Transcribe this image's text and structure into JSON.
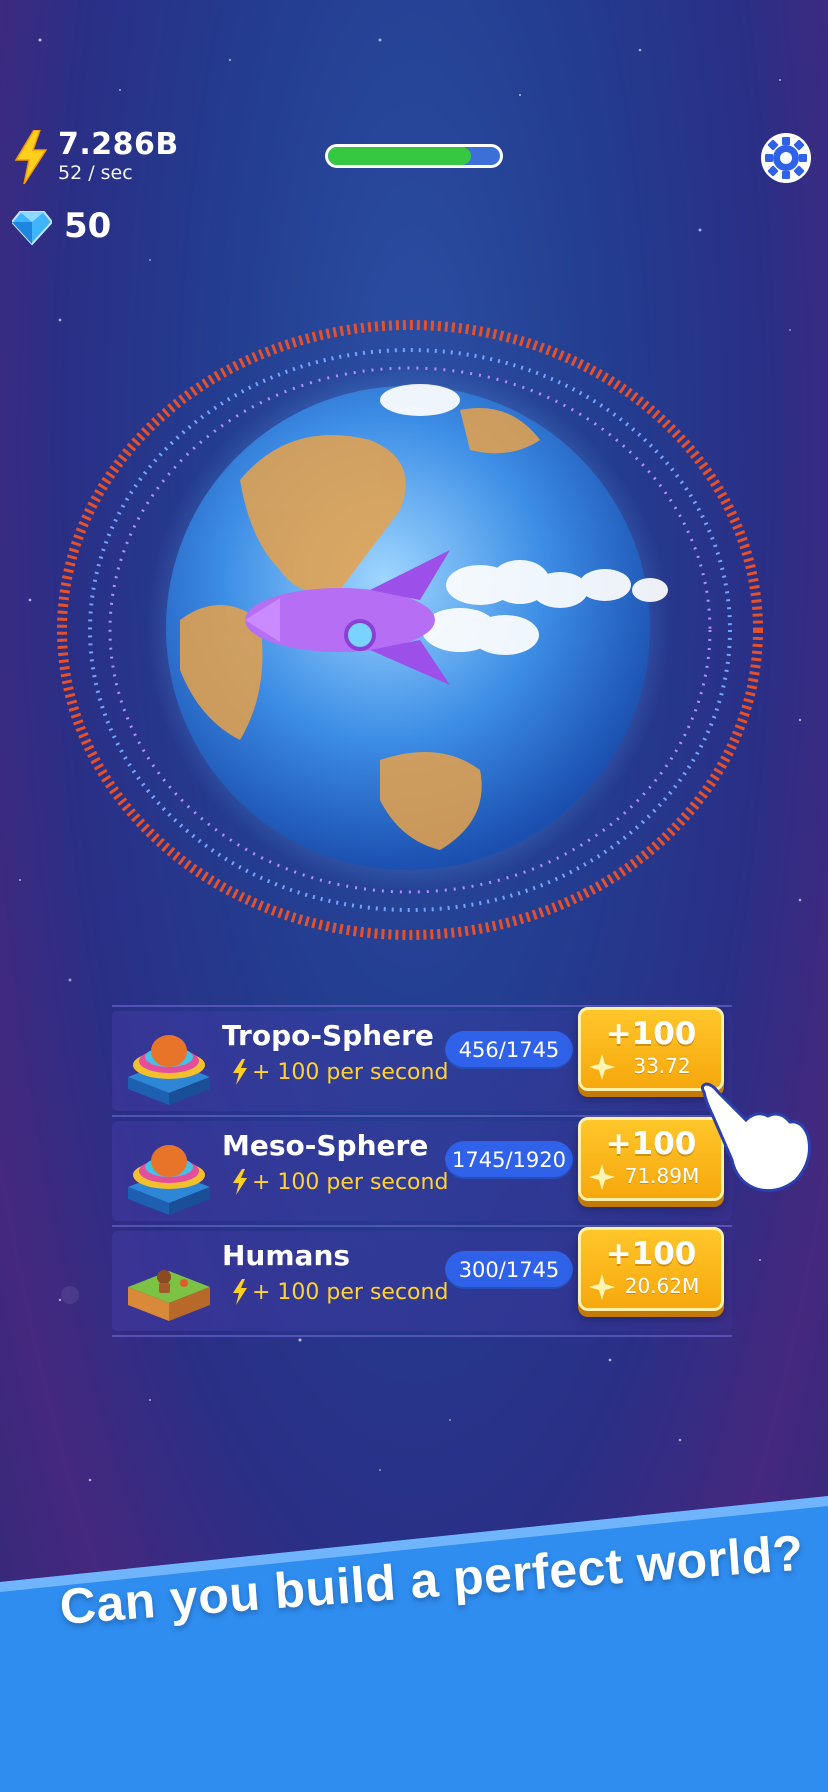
{
  "hud": {
    "energy_value": "7.286B",
    "energy_rate": "52 / sec",
    "gems_value": "50",
    "progress": 0.83,
    "settings_icon": "gear-icon"
  },
  "upgrades": [
    {
      "name": "Tropo-Sphere",
      "rate": "+ 100 per second",
      "count": "456/1745",
      "buy_label": "+100",
      "cost": "33.72",
      "icon": "layered-sphere-icon"
    },
    {
      "name": "Meso-Sphere",
      "rate": "+ 100 per second",
      "count": "1745/1920",
      "buy_label": "+100",
      "cost": "71.89M",
      "icon": "layered-sphere-icon"
    },
    {
      "name": "Humans",
      "rate": "+ 100 per second",
      "count": "300/1745",
      "buy_label": "+100",
      "cost": "20.62M",
      "icon": "humans-block-icon"
    }
  ],
  "banner": {
    "text": "Can you build a perfect world?"
  },
  "colors": {
    "green": "#36c840",
    "gold": "#f6a80d",
    "blue": "#2f62e8",
    "banner": "#2f8df0"
  }
}
